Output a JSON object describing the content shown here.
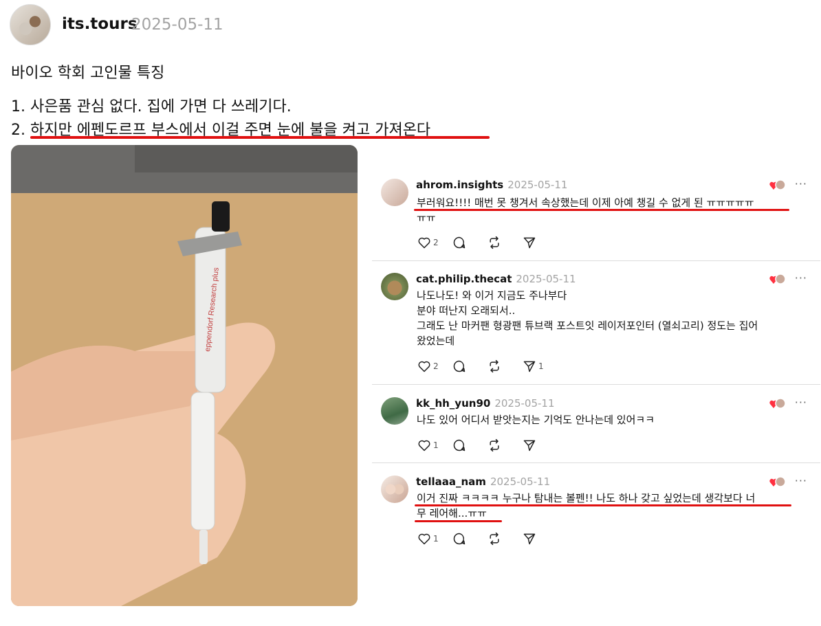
{
  "post": {
    "username": "its.tours",
    "date": "2025-05-11",
    "title": "바이오 학회 고인물 특징",
    "line1": "1. 사은품 관심 없다. 집에 가면 다 쓰레기다.",
    "line2": "2. 하지만 에펜도르프 부스에서 이걸 주면 눈에 불을 켜고 가져온다",
    "image_text": "eppendorf Research plus"
  },
  "comments": [
    {
      "username": "ahrom.insights",
      "date": "2025-05-11",
      "text": "부러워요!!!! 매번 못 챙겨서 속상했는데 이제 아예 챙길 수 없게 된 ㅠㅠㅠㅠㅠ\nㅠㅠ",
      "likes": "2",
      "reposts": "",
      "shares": "",
      "more": "···"
    },
    {
      "username": "cat.philip.thecat",
      "date": "2025-05-11",
      "text": "나도나도! 와 이거 지금도 주나부다\n분야 떠난지 오래되서..\n그래도 난 마커팬 형광팬 튜브랙 포스트잇 레이저포인터 (열쇠고리) 정도는 집어\n왔었는데",
      "likes": "2",
      "reposts": "",
      "shares": "1",
      "more": "···"
    },
    {
      "username": "kk_hh_yun90",
      "date": "2025-05-11",
      "text": "나도 있어 어디서 받앗는지는 기억도 안나는데 있어ㅋㅋ",
      "likes": "1",
      "reposts": "",
      "shares": "",
      "more": "···"
    },
    {
      "username": "tellaaa_nam",
      "date": "2025-05-11",
      "text": "이거 진짜 ㅋㅋㅋㅋ 누구나 탐내는 볼펜!! 나도 하나 갖고 싶었는데 생각보다 너\n무 레어해...ㅠㅠ",
      "likes": "1",
      "reposts": "",
      "shares": "",
      "more": "···"
    }
  ],
  "icons": [
    "heart-icon",
    "comment-icon",
    "repost-icon",
    "share-icon",
    "more-icon",
    "liked-by-author-icon"
  ],
  "colors": {
    "underline": "#e01010",
    "date": "#a3a3a3",
    "divider": "#dcdcdc"
  }
}
